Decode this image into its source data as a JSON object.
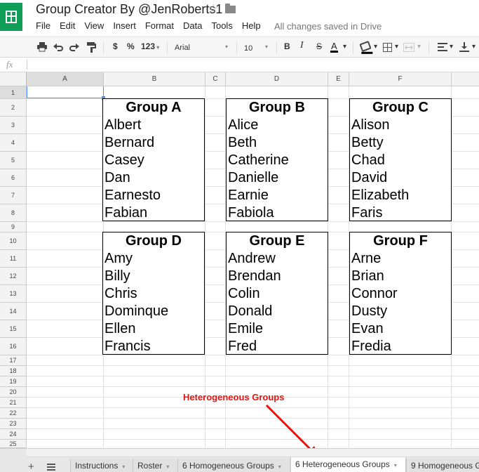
{
  "window": {
    "title": "Group Creator By @JenRoberts1",
    "save_status": "All changes saved in Drive"
  },
  "menu": [
    "File",
    "Edit",
    "View",
    "Insert",
    "Format",
    "Data",
    "Tools",
    "Help"
  ],
  "toolbar": {
    "currency": "$",
    "percent": "%",
    "number_format": "123",
    "font": "Arial",
    "font_size": "10",
    "bold": "B",
    "italic": "I",
    "strike": "S",
    "text_color": "A"
  },
  "formula_bar": {
    "fx": "fx",
    "value": ""
  },
  "columns": [
    "A",
    "B",
    "C",
    "D",
    "E",
    "F"
  ],
  "rows": [
    "1",
    "2",
    "3",
    "4",
    "5",
    "6",
    "7",
    "8",
    "9",
    "10",
    "11",
    "12",
    "13",
    "14",
    "15",
    "16",
    "17",
    "18",
    "19",
    "20",
    "21",
    "22",
    "23",
    "24",
    "25"
  ],
  "groups": [
    {
      "title": "Group A",
      "members": [
        "Albert",
        "Bernard",
        "Casey",
        "Dan",
        "Earnesto",
        "Fabian"
      ]
    },
    {
      "title": "Group B",
      "members": [
        "Alice",
        "Beth",
        "Catherine",
        "Danielle",
        "Earnie",
        "Fabiola"
      ]
    },
    {
      "title": "Group C",
      "members": [
        "Alison",
        "Betty",
        "Chad",
        "David",
        "Elizabeth",
        "Faris"
      ]
    },
    {
      "title": "Group D",
      "members": [
        "Amy",
        "Billy",
        "Chris",
        "Dominque",
        "Ellen",
        "Francis"
      ]
    },
    {
      "title": "Group E",
      "members": [
        "Andrew",
        "Brendan",
        "Colin",
        "Donald",
        "Emile",
        "Fred"
      ]
    },
    {
      "title": "Group F",
      "members": [
        "Arne",
        "Brian",
        "Connor",
        "Dusty",
        "Evan",
        "Fredia"
      ]
    }
  ],
  "annotation": {
    "label": "Heterogeneous Groups",
    "color": "#e8130f"
  },
  "sheet_tabs": {
    "add": "+",
    "items": [
      "Instructions",
      "Roster",
      "6 Homogeneous Groups",
      "6 Heterogeneous Groups",
      "9 Homogeneous G"
    ],
    "active_index": 3
  },
  "colors": {
    "brand": "#0f9d58",
    "selection": "#4d90fe"
  }
}
